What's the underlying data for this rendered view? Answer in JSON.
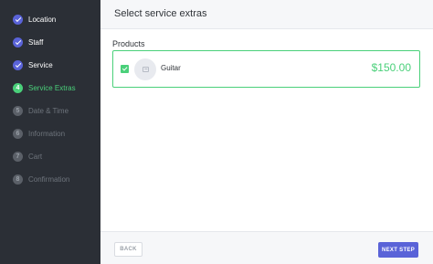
{
  "sidebar": {
    "steps": [
      {
        "index": "1",
        "label": "Location",
        "state": "done"
      },
      {
        "index": "2",
        "label": "Staff",
        "state": "done"
      },
      {
        "index": "3",
        "label": "Service",
        "state": "done"
      },
      {
        "index": "4",
        "label": "Service Extras",
        "state": "active"
      },
      {
        "index": "5",
        "label": "Date & Time",
        "state": "todo"
      },
      {
        "index": "6",
        "label": "Information",
        "state": "todo"
      },
      {
        "index": "7",
        "label": "Cart",
        "state": "todo"
      },
      {
        "index": "8",
        "label": "Confirmation",
        "state": "todo"
      }
    ]
  },
  "header": {
    "title": "Select service extras"
  },
  "products": {
    "section_title": "Products",
    "items": [
      {
        "name": "Guitar",
        "price": "$150.00",
        "checked": true,
        "thumb_icon": "image-icon"
      }
    ]
  },
  "footer": {
    "back_label": "BACK",
    "next_label": "NEXT STEP"
  },
  "colors": {
    "accent": "#5a63d8",
    "success": "#4ad07a",
    "sidebar_bg": "#2b2f36"
  }
}
